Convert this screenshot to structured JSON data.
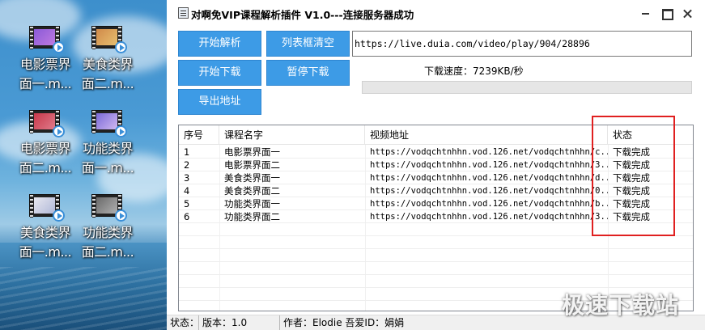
{
  "desktop": {
    "icons": [
      {
        "label_line1": "电影票界",
        "label_line2": "面一.m..."
      },
      {
        "label_line1": "美食类界",
        "label_line2": "面二.m..."
      },
      {
        "label_line1": "电影票界",
        "label_line2": "面二.m..."
      },
      {
        "label_line1": "功能类界",
        "label_line2": "面一.m..."
      },
      {
        "label_line1": "美食类界",
        "label_line2": "面一.m..."
      },
      {
        "label_line1": "功能类界",
        "label_line2": "面二.m..."
      }
    ]
  },
  "window": {
    "title": "对啊免VIP课程解析插件 V1.0---连接服务器成功",
    "icon": "app-window-icon",
    "controls": {
      "minimize": "minimize-icon",
      "maximize": "maximize-icon",
      "close": "close-icon"
    }
  },
  "toolbar": {
    "parse_label": "开始解析",
    "clear_list_label": "列表框清空",
    "start_download_label": "开始下载",
    "pause_download_label": "暂停下载",
    "export_label": "导出地址"
  },
  "url_input": {
    "value": "https://live.duia.com/video/play/904/28896"
  },
  "download": {
    "speed_text": "下载速度：7239KB/秒",
    "progress_fraction": 0
  },
  "table": {
    "columns": [
      "序号",
      "课程名字",
      "视频地址",
      "状态"
    ],
    "rows": [
      {
        "no": "1",
        "name": "电影票界面一",
        "url": "https://vodqchtnhhn.vod.126.net/vodqchtnhhn/c...",
        "status": "下载完成"
      },
      {
        "no": "2",
        "name": "电影票界面二",
        "url": "https://vodqchtnhhn.vod.126.net/vodqchtnhhn/3...",
        "status": "下载完成"
      },
      {
        "no": "3",
        "name": "美食类界面一",
        "url": "https://vodqchtnhhn.vod.126.net/vodqchtnhhn/d...",
        "status": "下载完成"
      },
      {
        "no": "4",
        "name": "美食类界面二",
        "url": "https://vodqchtnhhn.vod.126.net/vodqchtnhhn/0...",
        "status": "下载完成"
      },
      {
        "no": "5",
        "name": "功能类界面一",
        "url": "https://vodqchtnhhn.vod.126.net/vodqchtnhhn/b...",
        "status": "下载完成"
      },
      {
        "no": "6",
        "name": "功能类界面二",
        "url": "https://vodqchtnhhn.vod.126.net/vodqchtnhhn/3...",
        "status": "下载完成"
      }
    ]
  },
  "statusbar": {
    "status_label": "状态：",
    "version_text": "版本：1.0",
    "author_text": "作者：Elodie 吾爱ID：娟娟"
  },
  "watermark": {
    "text": "极速下载站"
  },
  "colors": {
    "button_bg": "#3d9be6",
    "highlight_border": "#e02020",
    "progress_fill": "#06b025"
  }
}
